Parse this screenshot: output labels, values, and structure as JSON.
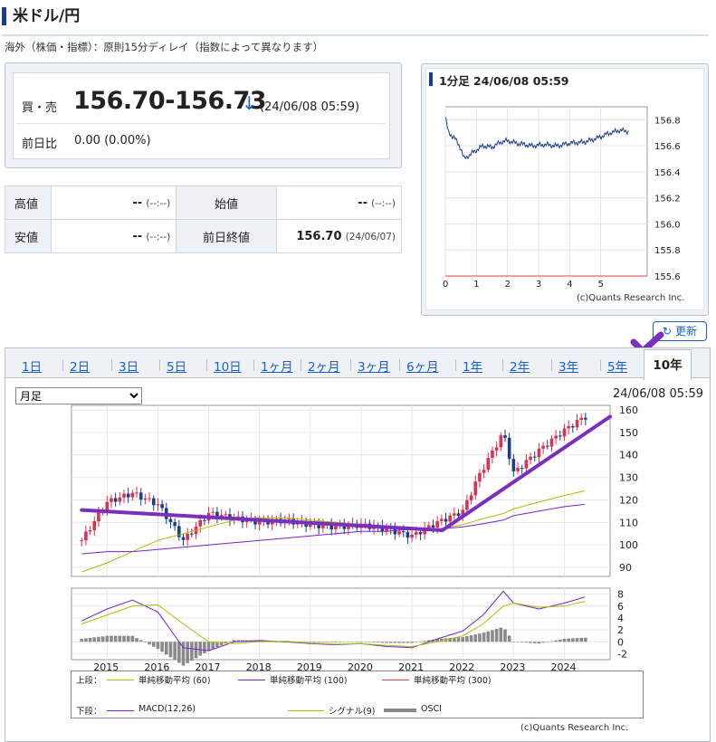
{
  "header": {
    "title": "米ドル/円",
    "notice": "海外（株価・指標）：原則15分ディレイ（指数によって異なります）"
  },
  "quote": {
    "bid_ask_label": "買・売",
    "price": "156.70-156.73",
    "direction": "↓",
    "time": "(24/06/08 05:59)",
    "change_label": "前日比",
    "change": "0.00 (0.00%)"
  },
  "ohlc": {
    "high_label": "高値",
    "high_value": "--",
    "high_time": "(--:--)",
    "open_label": "始値",
    "open_value": "--",
    "open_time": "(--:--)",
    "low_label": "安値",
    "low_value": "--",
    "low_time": "(--:--)",
    "prev_close_label": "前日終値",
    "prev_close_value": "156.70",
    "prev_close_time": "(24/06/07)"
  },
  "mini_chart": {
    "title": "1分足 24/06/08 05:59",
    "copyright": "(c)Quants Research Inc.",
    "y_ticks": [
      "156.8",
      "156.6",
      "156.4",
      "156.2",
      "156.0",
      "155.8",
      "155.6"
    ],
    "x_ticks": [
      "0",
      "1",
      "2",
      "3",
      "4",
      "5"
    ]
  },
  "refresh_label": "更新",
  "tabs": [
    "1日",
    "2日",
    "3日",
    "5日",
    "10日",
    "1ヶ月",
    "2ヶ月",
    "3ヶ月",
    "6ヶ月",
    "1年",
    "2年",
    "3年",
    "5年",
    "10年"
  ],
  "active_tab": "10年",
  "period_select": {
    "selected": "月足"
  },
  "main_chart": {
    "time": "24/06/08 05:59",
    "y_ticks": [
      "160",
      "150",
      "140",
      "130",
      "120",
      "110",
      "100",
      "90"
    ],
    "macd_ticks": [
      "8",
      "6",
      "4",
      "2",
      "0",
      "-2"
    ],
    "x_ticks": [
      "2015",
      "2016",
      "2017",
      "2018",
      "2019",
      "2020",
      "2021",
      "2022",
      "2023",
      "2024"
    ],
    "copyright": "(c)Quants Research Inc."
  },
  "legend": {
    "upper_label": "上段：",
    "sma60": "単純移動平均 (60)",
    "sma100": "単純移動平均 (100)",
    "sma300": "単純移動平均 (300)",
    "lower_label": "下段：",
    "macd": "MACD(12,26)",
    "signal": "シグナル(9)",
    "osci": "OSCI"
  },
  "colors": {
    "accent": "#1b5fc9",
    "up": "#e03050",
    "down": "#1a3e8c",
    "sma60": "#a8c000",
    "sma100": "#7b22c8",
    "sma300": "#e04040",
    "annotation": "#7a2fbf"
  },
  "chart_data": [
    {
      "type": "line",
      "title": "1分足 24/06/08 05:59",
      "x": [
        0,
        0.1,
        0.3,
        0.5,
        0.6,
        0.9,
        1.2,
        1.5,
        1.8,
        2.0,
        2.3,
        2.8,
        3.2,
        3.6,
        4.0,
        4.5,
        4.9,
        5.2,
        5.6,
        5.9
      ],
      "values": [
        156.82,
        156.7,
        156.66,
        156.58,
        156.5,
        156.55,
        156.6,
        156.59,
        156.63,
        156.64,
        156.62,
        156.6,
        156.61,
        156.6,
        156.62,
        156.63,
        156.66,
        156.69,
        156.72,
        156.71
      ],
      "ylim": [
        155.6,
        156.9
      ],
      "xlim": [
        0,
        6.5
      ]
    },
    {
      "type": "line",
      "title": "",
      "x": [
        2014.5,
        2015.0,
        2015.5,
        2016.0,
        2016.5,
        2017.0,
        2017.5,
        2018.0,
        2018.5,
        2019.0,
        2019.5,
        2020.0,
        2020.5,
        2021.0,
        2021.5,
        2022.0,
        2022.3,
        2022.8,
        2023.0,
        2023.5,
        2024.0,
        2024.4
      ],
      "series": [
        {
          "values": [
            102,
            119,
            123,
            118,
            102,
            114,
            112,
            110,
            111,
            109,
            108,
            109,
            107,
            104,
            110,
            115,
            130,
            150,
            132,
            142,
            151,
            157
          ]
        },
        {
          "values": [
            88,
            92,
            97,
            102,
            105,
            108,
            111,
            112,
            112,
            111,
            110,
            109,
            108,
            107,
            107,
            109,
            111,
            114,
            116,
            119,
            122,
            124
          ]
        },
        {
          "values": [
            96,
            97,
            97,
            98,
            99,
            100,
            101,
            102,
            103,
            104,
            105,
            106,
            106,
            107,
            107,
            108,
            109,
            111,
            113,
            115,
            117,
            118
          ]
        }
      ],
      "ylim": [
        86,
        162
      ],
      "xlim": [
        2014.3,
        2024.9
      ]
    },
    {
      "type": "line",
      "x": [
        2014.5,
        2015.0,
        2015.5,
        2016.0,
        2016.5,
        2017.0,
        2017.5,
        2018.0,
        2018.5,
        2019.0,
        2019.5,
        2020.0,
        2020.5,
        2021.0,
        2021.5,
        2022.0,
        2022.4,
        2022.8,
        2023.0,
        2023.5,
        2024.0,
        2024.4
      ],
      "series": [
        {
          "values": [
            3.5,
            5.5,
            7.0,
            5.0,
            -1.0,
            -1.5,
            0.0,
            0.2,
            0.0,
            -0.3,
            -0.5,
            -0.3,
            -0.8,
            -1.0,
            0.5,
            1.8,
            4.5,
            8.5,
            6.5,
            5.5,
            6.5,
            7.5
          ]
        },
        {
          "values": [
            3.0,
            4.5,
            6.0,
            6.2,
            3.0,
            0.0,
            -0.3,
            0.0,
            0.1,
            -0.2,
            -0.4,
            -0.3,
            -0.6,
            -0.8,
            0.0,
            1.0,
            3.0,
            6.0,
            6.5,
            5.8,
            6.0,
            6.8
          ]
        },
        {
          "values": [
            0.5,
            1.0,
            1.0,
            -1.2,
            -4.0,
            -1.5,
            0.3,
            0.2,
            -0.1,
            -0.1,
            -0.1,
            0.0,
            -0.2,
            -0.2,
            0.5,
            0.8,
            1.5,
            2.5,
            0.0,
            -0.3,
            0.5,
            0.7
          ]
        }
      ],
      "ylim": [
        -3,
        9
      ],
      "xlim": [
        2014.3,
        2024.9
      ]
    }
  ]
}
